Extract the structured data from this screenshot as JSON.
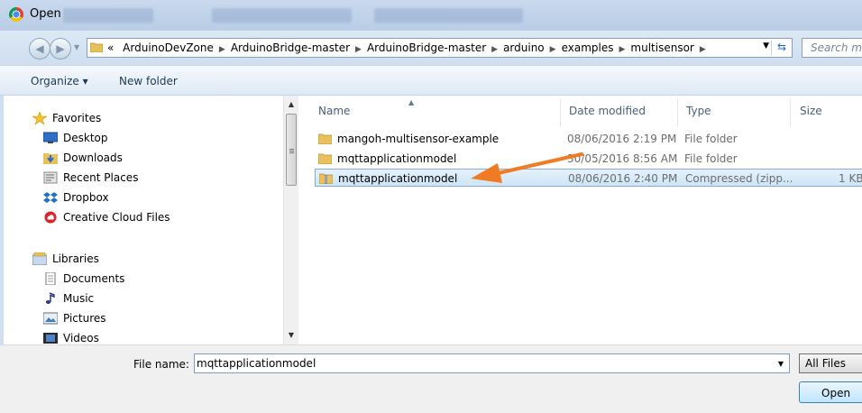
{
  "window": {
    "title": "Open"
  },
  "address_bar": {
    "overflow_marker": "«",
    "breadcrumbs": [
      "ArduinoDevZone",
      "ArduinoBridge-master",
      "ArduinoBridge-master",
      "arduino",
      "examples",
      "multisensor"
    ],
    "search_placeholder": "Search mu"
  },
  "toolbar": {
    "organize_label": "Organize ▾",
    "new_folder_label": "New folder"
  },
  "nav": {
    "favorites_label": "Favorites",
    "favorites": [
      "Desktop",
      "Downloads",
      "Recent Places",
      "Dropbox",
      "Creative Cloud Files"
    ],
    "libraries_label": "Libraries",
    "libraries": [
      "Documents",
      "Music",
      "Pictures",
      "Videos"
    ]
  },
  "file_list": {
    "columns": [
      "Name",
      "Date modified",
      "Type",
      "Size"
    ],
    "rows": [
      {
        "name": "mangoh-multisensor-example",
        "date": "08/06/2016 2:19 PM",
        "type": "File folder",
        "size": "",
        "icon": "folder-icon",
        "selected": false
      },
      {
        "name": "mqttapplicationmodel",
        "date": "30/05/2016 8:56 AM",
        "type": "File folder",
        "size": "",
        "icon": "folder-icon",
        "selected": false
      },
      {
        "name": "mqttapplicationmodel",
        "date": "08/06/2016 2:40 PM",
        "type": "Compressed (zipp...",
        "size": "1 KB",
        "icon": "zip-folder-icon",
        "selected": true
      }
    ]
  },
  "bottom": {
    "file_name_label": "File name:",
    "file_name_value": "mqttapplicationmodel",
    "filter_value": "All Files",
    "open_label": "Open"
  },
  "colors": {
    "annotation_arrow": "#f07b22",
    "selection_border": "#84acdd",
    "folder": "#e8c15a"
  }
}
